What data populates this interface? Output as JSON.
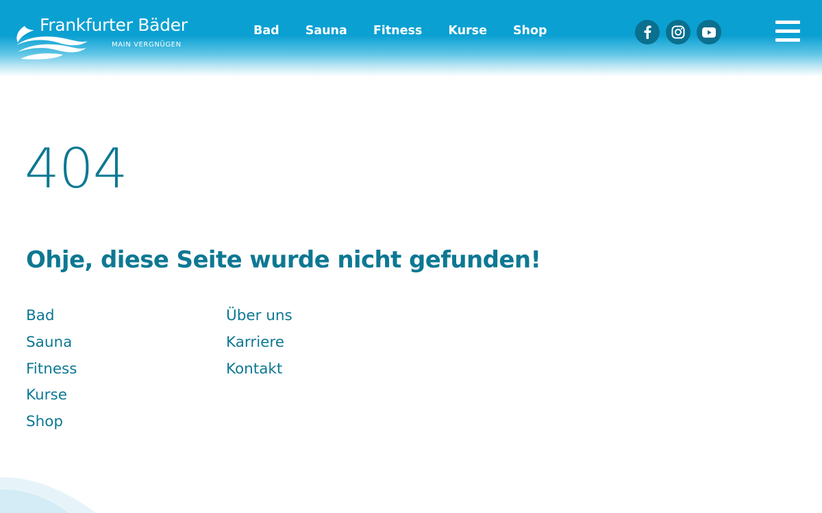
{
  "header": {
    "logo": {
      "title": "Frankfurter Bäder",
      "tagline": "MAIN VERGNÜGEN"
    },
    "nav": [
      {
        "label": "Bad"
      },
      {
        "label": "Sauna"
      },
      {
        "label": "Fitness"
      },
      {
        "label": "Kurse"
      },
      {
        "label": "Shop"
      }
    ],
    "social": [
      {
        "icon": "facebook-icon"
      },
      {
        "icon": "instagram-icon"
      },
      {
        "icon": "youtube-icon"
      }
    ],
    "menu_icon": "hamburger-menu-icon"
  },
  "main": {
    "error_code": "404",
    "heading": "Ohje, diese Seite wurde nicht gefunden!",
    "links_primary": [
      {
        "label": "Bad"
      },
      {
        "label": "Sauna"
      },
      {
        "label": "Fitness"
      },
      {
        "label": "Kurse"
      },
      {
        "label": "Shop"
      }
    ],
    "links_secondary": [
      {
        "label": "Über uns"
      },
      {
        "label": "Karriere"
      },
      {
        "label": "Kontakt"
      }
    ]
  },
  "colors": {
    "header_blue": "#0aa0d2",
    "accent_teal": "#0e7893",
    "social_circle": "#0b6f8e",
    "text_white": "#ffffff"
  }
}
